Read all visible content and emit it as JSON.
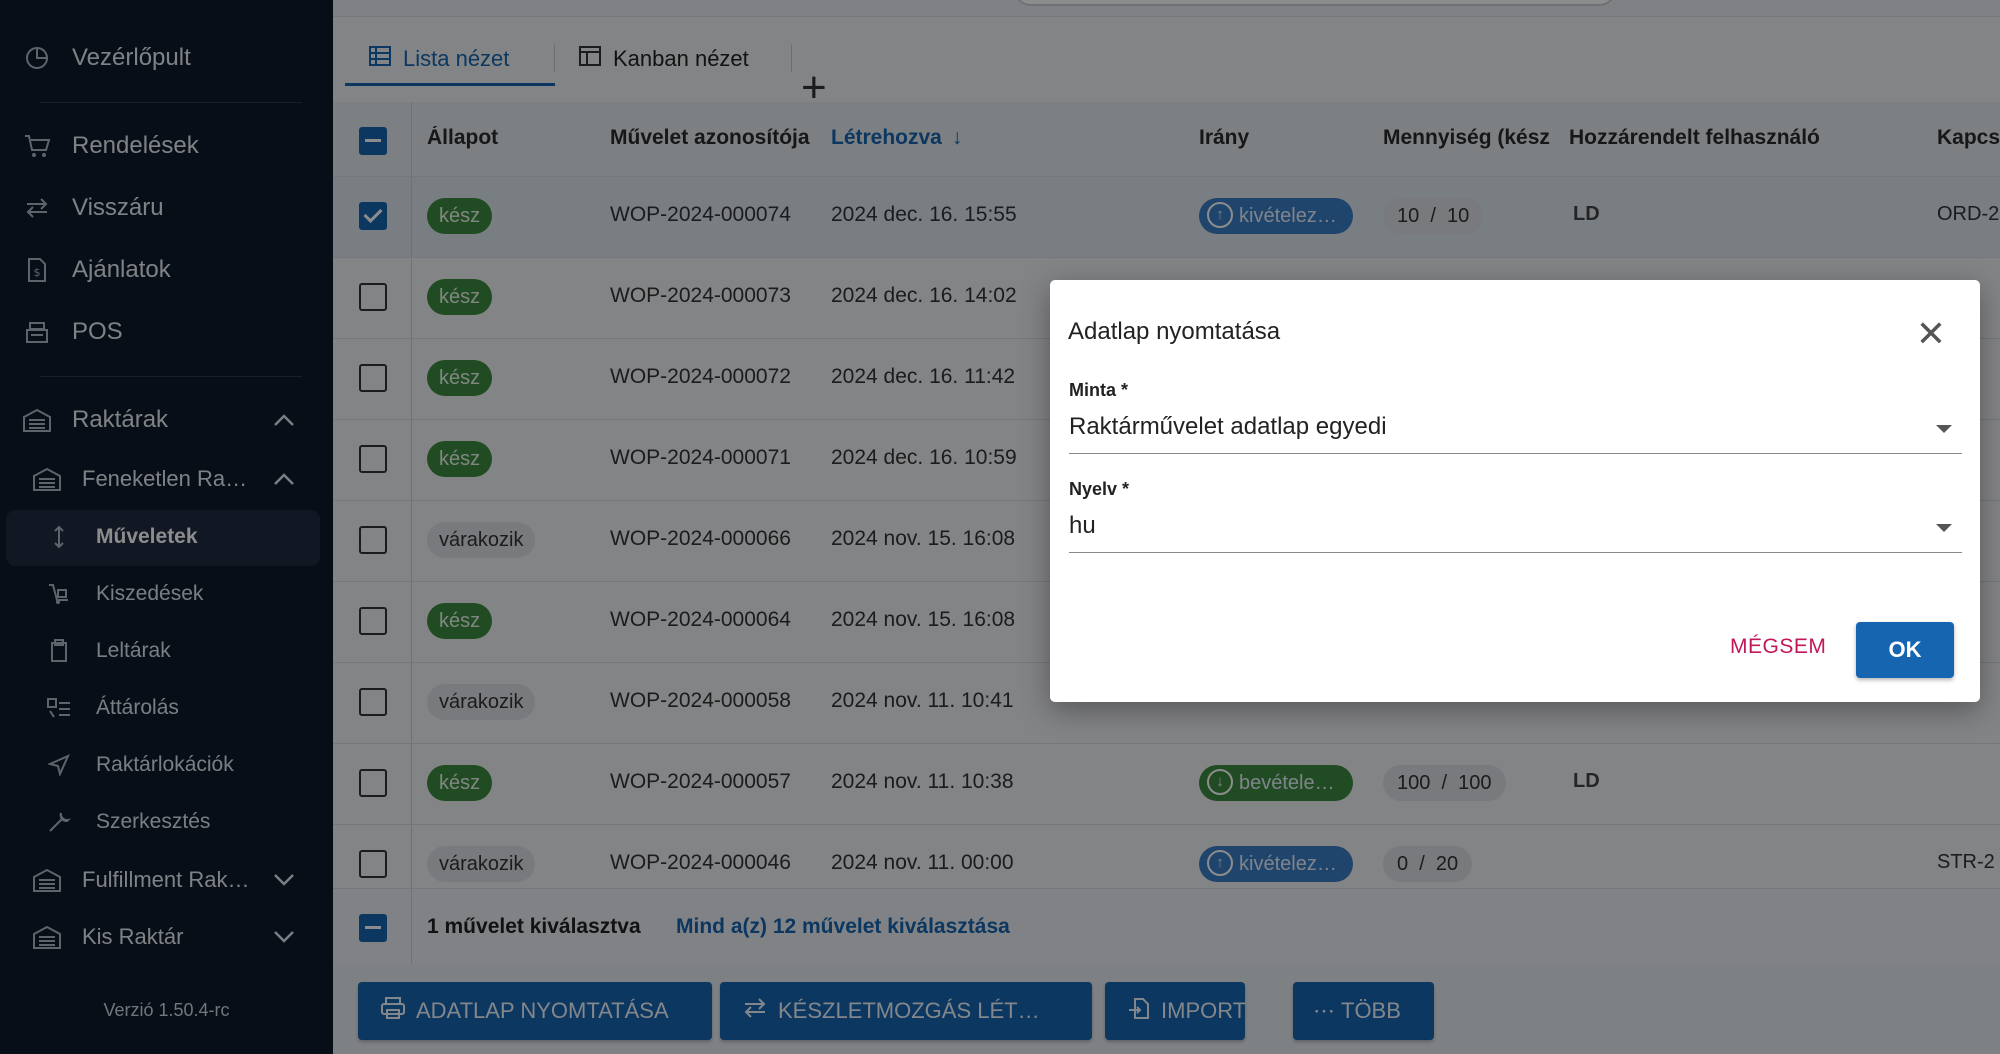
{
  "sidebar": {
    "items": [
      {
        "label": "Vezérlőpult"
      },
      {
        "label": "Rendelések"
      },
      {
        "label": "Visszáru"
      },
      {
        "label": "Ajánlatok"
      },
      {
        "label": "POS"
      },
      {
        "label": "Raktárak"
      },
      {
        "label": "Feneketlen Ra…"
      },
      {
        "label": "Műveletek"
      },
      {
        "label": "Kiszedések"
      },
      {
        "label": "Leltárak"
      },
      {
        "label": "Áttárolás"
      },
      {
        "label": "Raktárlokációk"
      },
      {
        "label": "Szerkesztés"
      },
      {
        "label": "Fulfillment Rak…"
      },
      {
        "label": "Kis Raktár"
      }
    ],
    "version": "Verzió 1.50.4-rc"
  },
  "tabs": [
    {
      "label": "Lista nézet"
    },
    {
      "label": "Kanban nézet"
    }
  ],
  "table": {
    "headers": [
      "Állapot",
      "Művelet azonosítója",
      "Létrehozva",
      "Irány",
      "Mennyiség (kész",
      "Hozzárendelt felhasználó",
      "Kapcs"
    ],
    "rows": [
      {
        "status": "kész",
        "id": "WOP-2024-000074",
        "created": "2024 dec. 16. 15:55",
        "dir": "kivételez…",
        "qty_done": "10",
        "qty_total": "10",
        "user": "LD",
        "conn": "ORD-2"
      },
      {
        "status": "kész",
        "id": "WOP-2024-000073",
        "created": "2024 dec. 16. 14:02"
      },
      {
        "status": "kész",
        "id": "WOP-2024-000072",
        "created": "2024 dec. 16. 11:42"
      },
      {
        "status": "kész",
        "id": "WOP-2024-000071",
        "created": "2024 dec. 16. 10:59"
      },
      {
        "status": "várakozik",
        "id": "WOP-2024-000066",
        "created": "2024 nov. 15. 16:08"
      },
      {
        "status": "kész",
        "id": "WOP-2024-000064",
        "created": "2024 nov. 15. 16:08"
      },
      {
        "status": "várakozik",
        "id": "WOP-2024-000058",
        "created": "2024 nov. 11. 10:41"
      },
      {
        "status": "kész",
        "id": "WOP-2024-000057",
        "created": "2024 nov. 11. 10:38",
        "dir": "bevétele…",
        "qty_done": "100",
        "qty_total": "100",
        "user": "LD"
      },
      {
        "status": "várakozik",
        "id": "WOP-2024-000046",
        "created": "2024 nov. 11. 00:00",
        "dir": "kivételez…",
        "qty_done": "0",
        "qty_total": "20",
        "conn": "STR-2"
      }
    ],
    "selection_text": "1 művelet kiválasztva",
    "select_all_link": "Mind a(z) 12 művelet kiválasztása"
  },
  "actions": [
    {
      "label": "ADATLAP NYOMTATÁSA",
      "icon": "printer-icon"
    },
    {
      "label": "KÉSZLETMOZGÁS LÉT…",
      "icon": "transfer-icon"
    },
    {
      "label": "IMPORT",
      "icon": "import-icon"
    },
    {
      "label": "TÖBB",
      "icon": "more-icon"
    }
  ],
  "dialog": {
    "title": "Adatlap nyomtatása",
    "template_label": "Minta *",
    "template_value": "Raktárművelet adatlap egyedi",
    "language_label": "Nyelv *",
    "language_value": "hu",
    "cancel": "MÉGSEM",
    "ok": "OK"
  },
  "colors": {
    "accent": "#1565b0",
    "sidebar": "#0f1b2d",
    "done": "#3d8b40",
    "cancel": "#c2185b"
  }
}
